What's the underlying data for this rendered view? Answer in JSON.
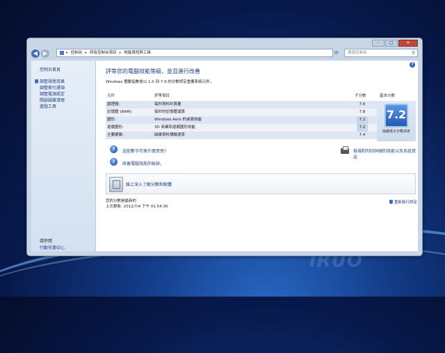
{
  "window": {
    "title_buttons": [
      "minimize",
      "maximize",
      "close"
    ]
  },
  "addressbar": {
    "crumbs": [
      "控制台",
      "所有控制台項目",
      "效能資訊與工具"
    ],
    "search_placeholder": "搜尋控制台"
  },
  "sidebar": {
    "home_label": "控制台首頁",
    "items": [
      "調整視覺效果",
      "調整索引選項",
      "調整電源設定",
      "開啟磁碟清理",
      "進階工具"
    ],
    "see_also": "請參閱",
    "action_center": "行動作業中心"
  },
  "main": {
    "title": "評等您的電腦效能等級，並且進行改善",
    "subtitle": "Windows 體驗指數會以 1.0 到 7.9 的分數評定重要系統元件。",
    "table": {
      "headers": {
        "component": "元件",
        "rating_item": "評等項目",
        "subscore": "子分數",
        "base_score": "基本分數"
      },
      "rows": [
        {
          "component": "處理器:",
          "item": "每秒資料計算量",
          "score": "7.6"
        },
        {
          "component": "記憶體 (RAM):",
          "item": "每秒的記憶體運算",
          "score": "7.8"
        },
        {
          "component": "圖形:",
          "item": "Windows Aero 的桌面效能",
          "score": "7.2"
        },
        {
          "component": "遊戲圖形:",
          "item": "3D 商業和遊戲圖形效能",
          "score": "7.2"
        },
        {
          "component": "主要硬碟:",
          "item": "磁碟資料傳輸速率",
          "score": "7.4"
        }
      ],
      "base_score": "7.2",
      "base_caption": "由最低子分數決定"
    },
    "links": {
      "what_mean": "這些數字代表什麼意思?",
      "tips": "改善電腦效能的秘訣。",
      "print": "檢視和列印詳細的效能以及系統資訊",
      "learn_more": "線上深入了解分數和軟體"
    },
    "status": {
      "score_current": "您的分數是最新的",
      "last_update": "上次更新: 2012/7/4 下午 01:54:36",
      "rerun": "重新執行評定"
    }
  },
  "desktop": {
    "watermark": "IRUO"
  }
}
